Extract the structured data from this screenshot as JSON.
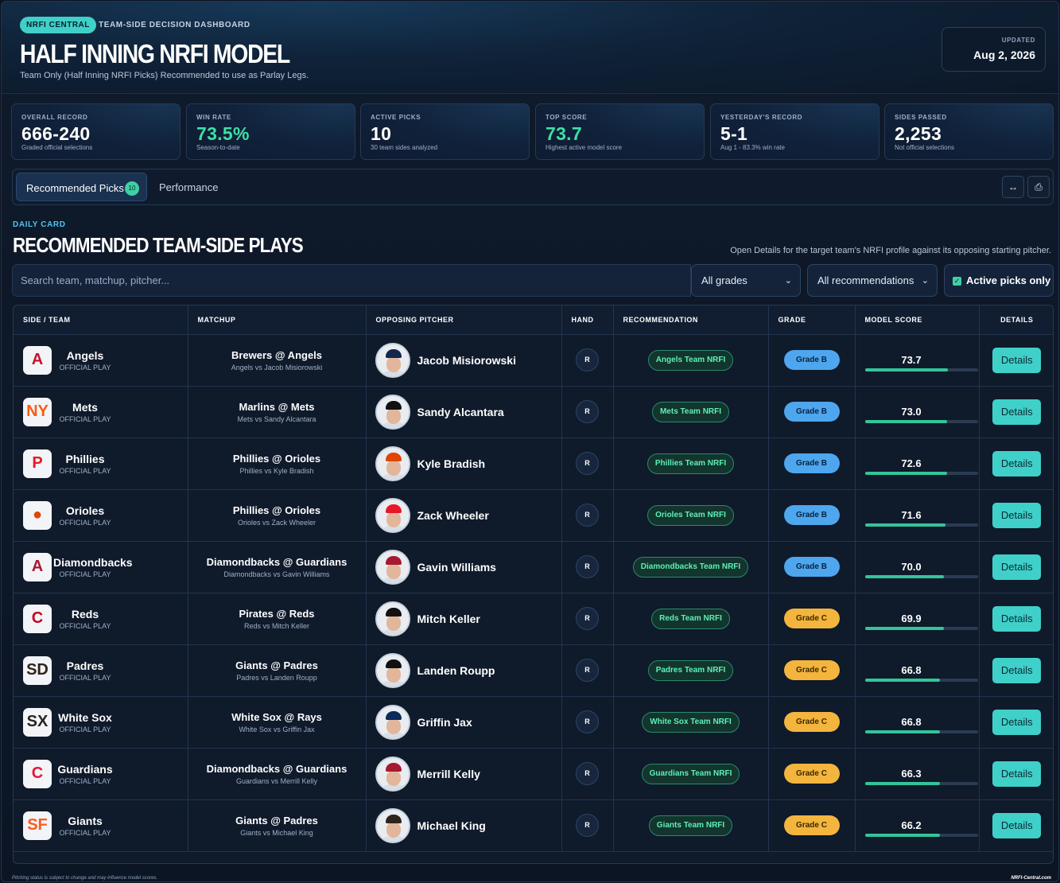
{
  "header": {
    "brand": "NRFI CENTRAL",
    "eyebrow": "TEAM-SIDE DECISION DASHBOARD",
    "title": "HALF INNING NRFI MODEL",
    "subtitle": "Team Only (Half Inning NRFI Picks) Recommended to use as Parlay Legs.",
    "updated_label": "UPDATED",
    "updated_date": "Aug 2, 2026"
  },
  "stats": [
    {
      "label": "OVERALL RECORD",
      "value": "666-240",
      "sub": "Graded official selections"
    },
    {
      "label": "WIN RATE",
      "value": "73.5%",
      "sub": "Season-to-date"
    },
    {
      "label": "ACTIVE PICKS",
      "value": "10",
      "sub": "30 team sides analyzed"
    },
    {
      "label": "TOP SCORE",
      "value": "73.7",
      "sub": "Highest active model score"
    },
    {
      "label": "YESTERDAY'S RECORD",
      "value": "5-1",
      "sub": "Aug 1 - 83.3% win rate"
    },
    {
      "label": "SIDES PASSED",
      "value": "2,253",
      "sub": "Not official selections"
    }
  ],
  "tabs": {
    "recommended_label": "Recommended Picks",
    "recommended_count": "10",
    "performance_label": "Performance",
    "expand_icon_glyph": "↔",
    "share_icon_glyph": "⎙"
  },
  "section": {
    "eyebrow": "DAILY CARD",
    "title": "RECOMMENDED TEAM-SIDE PLAYS",
    "note": "Open Details for the target team's NRFI profile against its opposing starting pitcher."
  },
  "filters": {
    "search_placeholder": "Search team, matchup, pitcher...",
    "grades_value": "All grades",
    "recs_value": "All recommendations",
    "active_only_label": "Active picks only",
    "chevron_glyph": "⌄",
    "check_glyph": "✓"
  },
  "table": {
    "headers": [
      "SIDE / TEAM",
      "MATCHUP",
      "OPPOSING PITCHER",
      "HAND",
      "RECOMMENDATION",
      "GRADE",
      "MODEL SCORE",
      "DETAILS"
    ],
    "details_label": "Details",
    "rows": [
      {
        "team": "Angels",
        "tag": "OFFICIAL PLAY",
        "logo": "A",
        "logo_color": "#c8102e",
        "matchup": "Brewers @ Angels",
        "matchup_sub": "Angels vs Jacob Misiorowski",
        "pitcher": "Jacob Misiorowski",
        "cap_color": "#12284b",
        "hand": "R",
        "rec": "Angels Team NRFI",
        "grade": "Grade B",
        "score": "73.7",
        "score_pct": 73.7
      },
      {
        "team": "Mets",
        "tag": "OFFICIAL PLAY",
        "logo": "NY",
        "logo_color": "#ff5910",
        "matchup": "Marlins @ Mets",
        "matchup_sub": "Mets vs Sandy Alcantara",
        "pitcher": "Sandy Alcantara",
        "cap_color": "#111111",
        "hand": "R",
        "rec": "Mets Team NRFI",
        "grade": "Grade B",
        "score": "73.0",
        "score_pct": 73.0
      },
      {
        "team": "Phillies",
        "tag": "OFFICIAL PLAY",
        "logo": "P",
        "logo_color": "#e81828",
        "matchup": "Phillies @ Orioles",
        "matchup_sub": "Phillies vs Kyle Bradish",
        "pitcher": "Kyle Bradish",
        "cap_color": "#df4601",
        "hand": "R",
        "rec": "Phillies Team NRFI",
        "grade": "Grade B",
        "score": "72.6",
        "score_pct": 72.6
      },
      {
        "team": "Orioles",
        "tag": "OFFICIAL PLAY",
        "logo": "●",
        "logo_color": "#df4601",
        "matchup": "Phillies @ Orioles",
        "matchup_sub": "Orioles vs Zack Wheeler",
        "pitcher": "Zack Wheeler",
        "cap_color": "#e81828",
        "hand": "R",
        "rec": "Orioles Team NRFI",
        "grade": "Grade B",
        "score": "71.6",
        "score_pct": 71.6
      },
      {
        "team": "Diamondbacks",
        "tag": "OFFICIAL PLAY",
        "logo": "A",
        "logo_color": "#a71930",
        "matchup": "Diamondbacks @ Guardians",
        "matchup_sub": "Diamondbacks vs Gavin Williams",
        "pitcher": "Gavin Williams",
        "cap_color": "#a71930",
        "hand": "R",
        "rec": "Diamondbacks Team NRFI",
        "grade": "Grade B",
        "score": "70.0",
        "score_pct": 70.0
      },
      {
        "team": "Reds",
        "tag": "OFFICIAL PLAY",
        "logo": "C",
        "logo_color": "#c6011f",
        "matchup": "Pirates @ Reds",
        "matchup_sub": "Reds vs Mitch Keller",
        "pitcher": "Mitch Keller",
        "cap_color": "#111111",
        "hand": "R",
        "rec": "Reds Team NRFI",
        "grade": "Grade C",
        "score": "69.9",
        "score_pct": 69.9
      },
      {
        "team": "Padres",
        "tag": "OFFICIAL PLAY",
        "logo": "SD",
        "logo_color": "#2f241d",
        "matchup": "Giants @ Padres",
        "matchup_sub": "Padres vs Landen Roupp",
        "pitcher": "Landen Roupp",
        "cap_color": "#111111",
        "hand": "R",
        "rec": "Padres Team NRFI",
        "grade": "Grade C",
        "score": "66.8",
        "score_pct": 66.8
      },
      {
        "team": "White Sox",
        "tag": "OFFICIAL PLAY",
        "logo": "SX",
        "logo_color": "#27251f",
        "matchup": "White Sox @ Rays",
        "matchup_sub": "White Sox vs Griffin Jax",
        "pitcher": "Griffin Jax",
        "cap_color": "#092c5c",
        "hand": "R",
        "rec": "White Sox Team NRFI",
        "grade": "Grade C",
        "score": "66.8",
        "score_pct": 66.8
      },
      {
        "team": "Guardians",
        "tag": "OFFICIAL PLAY",
        "logo": "C",
        "logo_color": "#e31937",
        "matchup": "Diamondbacks @ Guardians",
        "matchup_sub": "Guardians vs Merrill Kelly",
        "pitcher": "Merrill Kelly",
        "cap_color": "#a71930",
        "hand": "R",
        "rec": "Guardians Team NRFI",
        "grade": "Grade C",
        "score": "66.3",
        "score_pct": 66.3
      },
      {
        "team": "Giants",
        "tag": "OFFICIAL PLAY",
        "logo": "SF",
        "logo_color": "#fd5a1e",
        "matchup": "Giants @ Padres",
        "matchup_sub": "Giants vs Michael King",
        "pitcher": "Michael King",
        "cap_color": "#2f241d",
        "hand": "R",
        "rec": "Giants Team NRFI",
        "grade": "Grade C",
        "score": "66.2",
        "score_pct": 66.2
      }
    ]
  },
  "footer": {
    "note": "Pitching status is subject to change and may influence model scores.",
    "site": "NRFI-Central.com"
  }
}
